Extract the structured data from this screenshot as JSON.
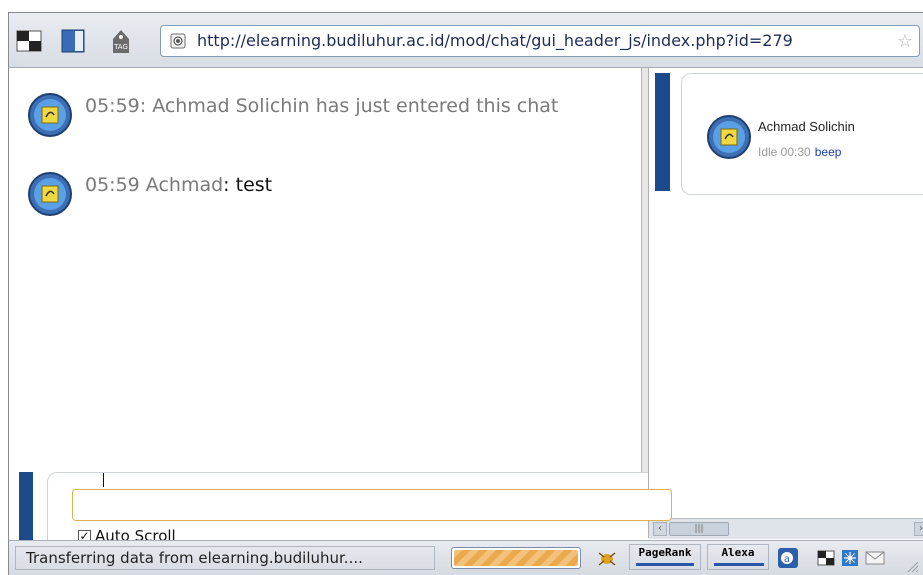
{
  "browser": {
    "url": "http://elearning.budiluhur.ac.id/mod/chat/gui_header_js/index.php?id=279",
    "toolbar_icons": [
      "window-tile-icon",
      "sidebar-icon",
      "tag-icon"
    ]
  },
  "chat": {
    "messages": [
      {
        "text": "05:59: Achmad Solichin has just entered this chat",
        "type": "system"
      },
      {
        "prefix": "05:59 ",
        "author": "Achmad",
        "sep": ": ",
        "body": "test",
        "type": "message"
      }
    ],
    "input_value": "",
    "autoscroll_label": "Auto Scroll",
    "autoscroll_checked": true
  },
  "users": [
    {
      "name": "Achmad Solichin",
      "idle": "Idle 00:30",
      "beep": "beep"
    }
  ],
  "status": {
    "text": "Transferring data from elearning.budiluhur....",
    "pagerank_label": "PageRank",
    "alexa_label": "Alexa",
    "progress": 1.0
  },
  "colors": {
    "accent_blue": "#1d4a8a",
    "link": "#1b3fb0",
    "input_border": "#e0b050"
  }
}
